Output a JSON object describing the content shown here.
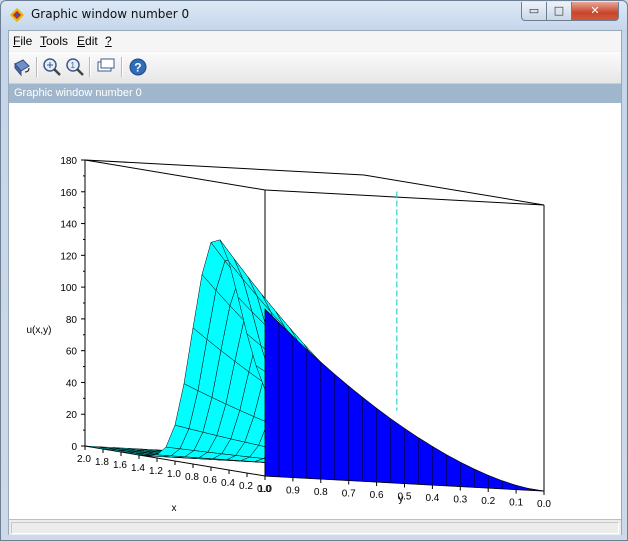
{
  "window": {
    "title": "Graphic window number 0",
    "min_glyph": "▭",
    "max_glyph": "□",
    "close_glyph": "✕"
  },
  "menu": {
    "items": [
      {
        "label": "File",
        "accel": "F",
        "rest": "ile"
      },
      {
        "label": "Tools",
        "accel": "T",
        "rest": "ools"
      },
      {
        "label": "Edit",
        "accel": "E",
        "rest": "dit"
      },
      {
        "label": "?",
        "accel": "?",
        "rest": ""
      }
    ]
  },
  "toolbar": {
    "buttons": [
      {
        "name": "rotate-icon"
      },
      {
        "name": "zoom-icon"
      },
      {
        "name": "unzoom-icon"
      },
      {
        "name": "datatip-icon"
      },
      {
        "name": "help-icon"
      }
    ]
  },
  "figure": {
    "banner": "Graphic window number 0"
  },
  "chart_data": {
    "type": "surface3d",
    "zlabel": "u(x,y)",
    "xlabel": "x",
    "ylabel": "y",
    "z_ticks": [
      "0",
      "20",
      "40",
      "60",
      "80",
      "100",
      "120",
      "140",
      "160",
      "180"
    ],
    "zlim": [
      0,
      180
    ],
    "x_ticks": [
      "2.0",
      "1.8",
      "1.6",
      "1.4",
      "1.2",
      "1.0",
      "0.8",
      "0.6",
      "0.4",
      "0.2",
      "0.0"
    ],
    "y_ticks": [
      "1.0",
      "0.9",
      "0.8",
      "0.7",
      "0.6",
      "0.5",
      "0.4",
      "0.3",
      "0.2",
      "0.1",
      "0.0"
    ],
    "xlim": [
      0,
      2
    ],
    "ylim": [
      0,
      1
    ],
    "peak": {
      "value": 158
    },
    "colors": {
      "front_face": "#00ffff",
      "back_face": "#0000ff",
      "mesh": "#000000",
      "guide": "#00cccc"
    }
  }
}
